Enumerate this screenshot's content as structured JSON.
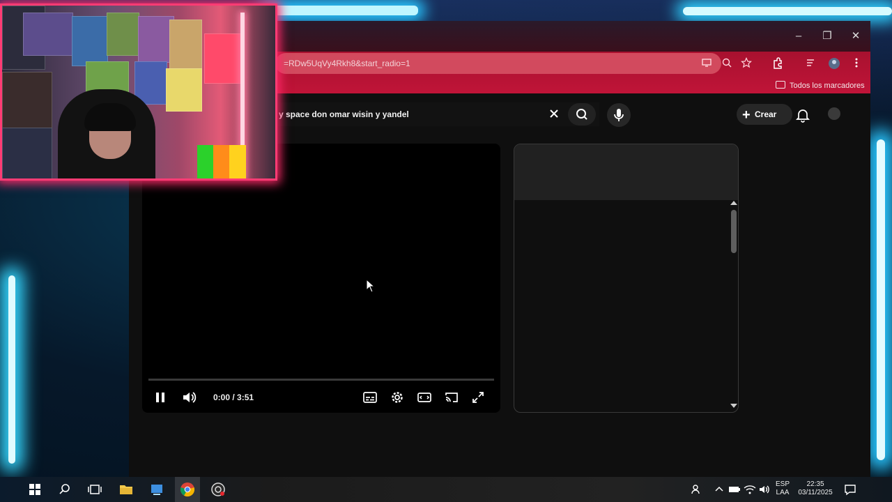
{
  "browser": {
    "window_controls": {
      "minimize": "–",
      "restore": "❐",
      "close": "✕"
    },
    "url": "=RDw5UqVy4Rkh8&start_radio=1",
    "bookmarks_label": "Todos los marcadores"
  },
  "youtube": {
    "search_query": "y space don omar wisin y yandel",
    "create_label": "Crear"
  },
  "player": {
    "time_display": "0:00 / 3:51",
    "progress": 0
  },
  "taskbar": {
    "lang_top": "ESP",
    "lang_bottom": "LAA",
    "clock_time": "22:35",
    "clock_date": "03/11/2025"
  },
  "colors": {
    "neon_cyan": "#29c6ff",
    "cam_border": "#ff3b74",
    "toolbar": "#c01438"
  }
}
